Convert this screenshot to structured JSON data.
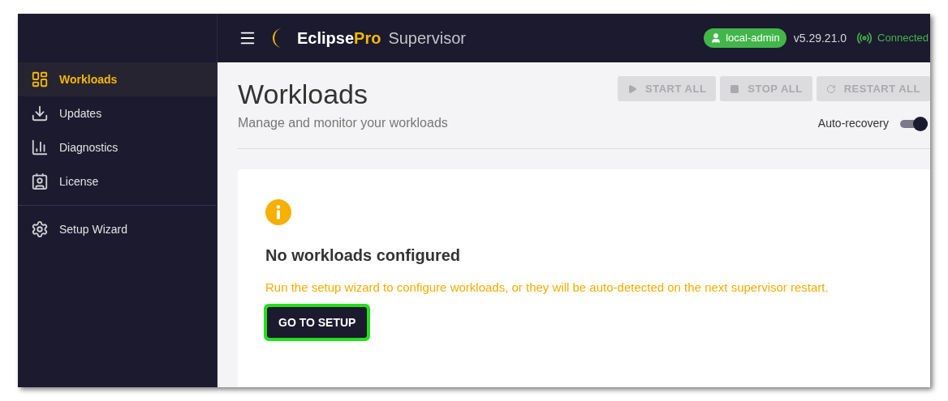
{
  "header": {
    "brand_primary": "Eclipse",
    "brand_accent": "Pro",
    "brand_secondary": "Supervisor",
    "user": "local-admin",
    "version": "v5.29.21.0",
    "connection": "Connected"
  },
  "sidebar": {
    "items": [
      {
        "label": "Workloads",
        "selected": true
      },
      {
        "label": "Updates",
        "selected": false
      },
      {
        "label": "Diagnostics",
        "selected": false
      },
      {
        "label": "License",
        "selected": false
      },
      {
        "label": "Setup Wizard",
        "selected": false
      }
    ]
  },
  "page": {
    "title": "Workloads",
    "subtitle": "Manage and monitor your workloads",
    "actions": [
      {
        "label": "START ALL",
        "disabled": true
      },
      {
        "label": "STOP ALL",
        "disabled": true
      },
      {
        "label": "RESTART ALL",
        "disabled": true
      }
    ],
    "auto_recovery": {
      "label": "Auto-recovery",
      "on": true
    }
  },
  "empty_state": {
    "title": "No workloads configured",
    "message": "Run the setup wizard to configure workloads, or they will be auto-detected on the next supervisor restart.",
    "button": "GO TO SETUP"
  }
}
